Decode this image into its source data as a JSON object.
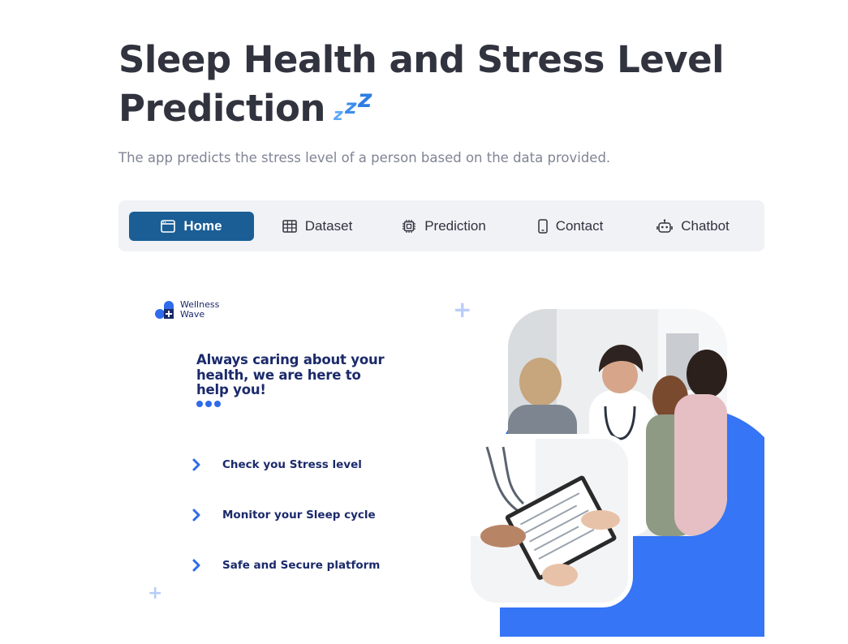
{
  "page": {
    "title": "Sleep Health and Stress Level Prediction",
    "title_emoji": "zzz-icon",
    "subtitle": "The app predicts the stress level of a person based on the data provided."
  },
  "nav": {
    "active": "Home",
    "items": [
      {
        "label": "Home",
        "icon": "window-icon"
      },
      {
        "label": "Dataset",
        "icon": "table-icon"
      },
      {
        "label": "Prediction",
        "icon": "cpu-icon"
      },
      {
        "label": "Contact",
        "icon": "phone-icon"
      },
      {
        "label": "Chatbot",
        "icon": "robot-icon"
      }
    ]
  },
  "banner": {
    "logo_line1": "Wellness",
    "logo_line2": "Wave",
    "headline": "Always caring about your health, we are here to help you!",
    "features": [
      "Check you Stress level",
      "Monitor your Sleep cycle",
      "Safe and Secure platform"
    ]
  },
  "colors": {
    "nav_active": "#1a5e95",
    "nav_bg": "#f0f2f6",
    "brand_blue": "#3575f6",
    "brand_navy": "#1b2a6b",
    "text": "#31333f",
    "subtitle": "#808495"
  }
}
